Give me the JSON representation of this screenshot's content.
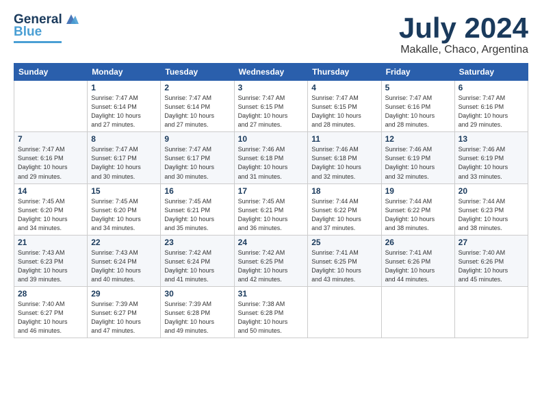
{
  "logo": {
    "line1": "General",
    "line2": "Blue"
  },
  "title": "July 2024",
  "subtitle": "Makalle, Chaco, Argentina",
  "days_of_week": [
    "Sunday",
    "Monday",
    "Tuesday",
    "Wednesday",
    "Thursday",
    "Friday",
    "Saturday"
  ],
  "weeks": [
    [
      {
        "day": "",
        "info": ""
      },
      {
        "day": "1",
        "info": "Sunrise: 7:47 AM\nSunset: 6:14 PM\nDaylight: 10 hours\nand 27 minutes."
      },
      {
        "day": "2",
        "info": "Sunrise: 7:47 AM\nSunset: 6:14 PM\nDaylight: 10 hours\nand 27 minutes."
      },
      {
        "day": "3",
        "info": "Sunrise: 7:47 AM\nSunset: 6:15 PM\nDaylight: 10 hours\nand 27 minutes."
      },
      {
        "day": "4",
        "info": "Sunrise: 7:47 AM\nSunset: 6:15 PM\nDaylight: 10 hours\nand 28 minutes."
      },
      {
        "day": "5",
        "info": "Sunrise: 7:47 AM\nSunset: 6:16 PM\nDaylight: 10 hours\nand 28 minutes."
      },
      {
        "day": "6",
        "info": "Sunrise: 7:47 AM\nSunset: 6:16 PM\nDaylight: 10 hours\nand 29 minutes."
      }
    ],
    [
      {
        "day": "7",
        "info": "Sunrise: 7:47 AM\nSunset: 6:16 PM\nDaylight: 10 hours\nand 29 minutes."
      },
      {
        "day": "8",
        "info": "Sunrise: 7:47 AM\nSunset: 6:17 PM\nDaylight: 10 hours\nand 30 minutes."
      },
      {
        "day": "9",
        "info": "Sunrise: 7:47 AM\nSunset: 6:17 PM\nDaylight: 10 hours\nand 30 minutes."
      },
      {
        "day": "10",
        "info": "Sunrise: 7:46 AM\nSunset: 6:18 PM\nDaylight: 10 hours\nand 31 minutes."
      },
      {
        "day": "11",
        "info": "Sunrise: 7:46 AM\nSunset: 6:18 PM\nDaylight: 10 hours\nand 32 minutes."
      },
      {
        "day": "12",
        "info": "Sunrise: 7:46 AM\nSunset: 6:19 PM\nDaylight: 10 hours\nand 32 minutes."
      },
      {
        "day": "13",
        "info": "Sunrise: 7:46 AM\nSunset: 6:19 PM\nDaylight: 10 hours\nand 33 minutes."
      }
    ],
    [
      {
        "day": "14",
        "info": "Sunrise: 7:45 AM\nSunset: 6:20 PM\nDaylight: 10 hours\nand 34 minutes."
      },
      {
        "day": "15",
        "info": "Sunrise: 7:45 AM\nSunset: 6:20 PM\nDaylight: 10 hours\nand 34 minutes."
      },
      {
        "day": "16",
        "info": "Sunrise: 7:45 AM\nSunset: 6:21 PM\nDaylight: 10 hours\nand 35 minutes."
      },
      {
        "day": "17",
        "info": "Sunrise: 7:45 AM\nSunset: 6:21 PM\nDaylight: 10 hours\nand 36 minutes."
      },
      {
        "day": "18",
        "info": "Sunrise: 7:44 AM\nSunset: 6:22 PM\nDaylight: 10 hours\nand 37 minutes."
      },
      {
        "day": "19",
        "info": "Sunrise: 7:44 AM\nSunset: 6:22 PM\nDaylight: 10 hours\nand 38 minutes."
      },
      {
        "day": "20",
        "info": "Sunrise: 7:44 AM\nSunset: 6:23 PM\nDaylight: 10 hours\nand 38 minutes."
      }
    ],
    [
      {
        "day": "21",
        "info": "Sunrise: 7:43 AM\nSunset: 6:23 PM\nDaylight: 10 hours\nand 39 minutes."
      },
      {
        "day": "22",
        "info": "Sunrise: 7:43 AM\nSunset: 6:24 PM\nDaylight: 10 hours\nand 40 minutes."
      },
      {
        "day": "23",
        "info": "Sunrise: 7:42 AM\nSunset: 6:24 PM\nDaylight: 10 hours\nand 41 minutes."
      },
      {
        "day": "24",
        "info": "Sunrise: 7:42 AM\nSunset: 6:25 PM\nDaylight: 10 hours\nand 42 minutes."
      },
      {
        "day": "25",
        "info": "Sunrise: 7:41 AM\nSunset: 6:25 PM\nDaylight: 10 hours\nand 43 minutes."
      },
      {
        "day": "26",
        "info": "Sunrise: 7:41 AM\nSunset: 6:26 PM\nDaylight: 10 hours\nand 44 minutes."
      },
      {
        "day": "27",
        "info": "Sunrise: 7:40 AM\nSunset: 6:26 PM\nDaylight: 10 hours\nand 45 minutes."
      }
    ],
    [
      {
        "day": "28",
        "info": "Sunrise: 7:40 AM\nSunset: 6:27 PM\nDaylight: 10 hours\nand 46 minutes."
      },
      {
        "day": "29",
        "info": "Sunrise: 7:39 AM\nSunset: 6:27 PM\nDaylight: 10 hours\nand 47 minutes."
      },
      {
        "day": "30",
        "info": "Sunrise: 7:39 AM\nSunset: 6:28 PM\nDaylight: 10 hours\nand 49 minutes."
      },
      {
        "day": "31",
        "info": "Sunrise: 7:38 AM\nSunset: 6:28 PM\nDaylight: 10 hours\nand 50 minutes."
      },
      {
        "day": "",
        "info": ""
      },
      {
        "day": "",
        "info": ""
      },
      {
        "day": "",
        "info": ""
      }
    ]
  ]
}
